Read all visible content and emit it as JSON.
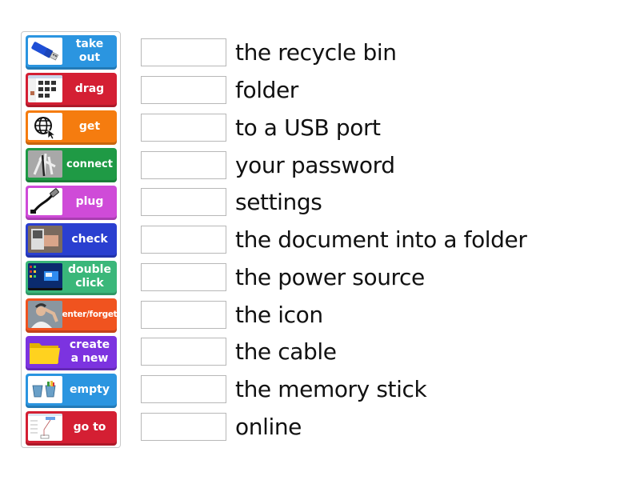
{
  "tiles": [
    {
      "label": "take\nout",
      "color": "#2b95e0",
      "icon": "usb-stick-icon"
    },
    {
      "label": "drag",
      "color": "#d41f33",
      "icon": "file-explorer-screenshot-icon"
    },
    {
      "label": "get",
      "color": "#f57c0f",
      "icon": "globe-cursor-icon"
    },
    {
      "label": "connect",
      "color": "#1f9a45",
      "icon": "cables-photo-icon"
    },
    {
      "label": "plug",
      "color": "#cf4bd8",
      "icon": "usb-cable-icon"
    },
    {
      "label": "check",
      "color": "#2a3fd0",
      "icon": "hardware-photo-icon"
    },
    {
      "label": "double\nclick",
      "color": "#3ab77a",
      "icon": "desktop-screenshot-icon"
    },
    {
      "label": "enter/forget",
      "color": "#f0531f",
      "icon": "forgetful-man-photo-icon"
    },
    {
      "label": "create\na new",
      "color": "#7c33e0",
      "icon": "folder-icon"
    },
    {
      "label": "empty",
      "color": "#2b95e0",
      "icon": "recycle-bin-icon"
    },
    {
      "label": "go to",
      "color": "#d41f33",
      "icon": "settings-screenshot-icon"
    }
  ],
  "phrases": [
    "the recycle bin",
    "folder",
    "to a USB port",
    "your password",
    "settings",
    "the document into a folder",
    "the power source",
    "the icon",
    "the cable",
    "the memory stick",
    "online"
  ]
}
